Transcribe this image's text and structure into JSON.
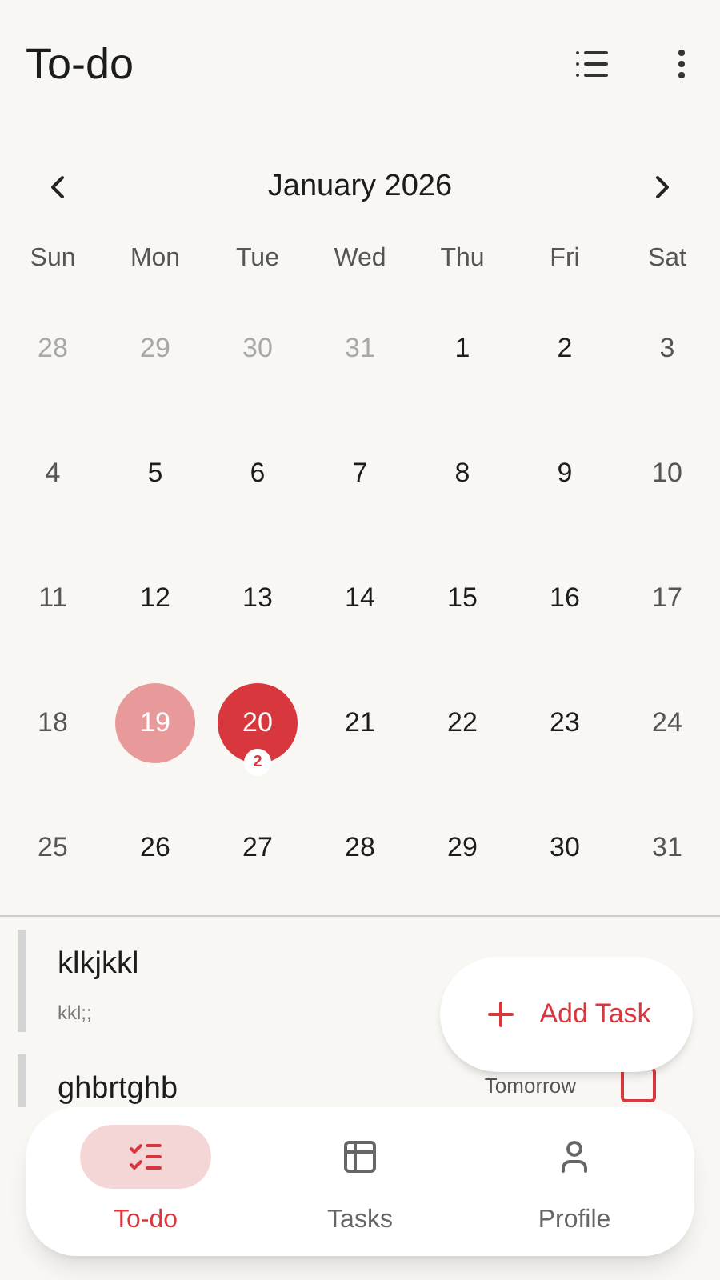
{
  "app_bar": {
    "title": "To-do"
  },
  "calendar": {
    "month": "January 2026",
    "weekdays": [
      "Sun",
      "Mon",
      "Tue",
      "Wed",
      "Thu",
      "Fri",
      "Sat"
    ],
    "days": [
      {
        "day": "28",
        "kind": "outside"
      },
      {
        "day": "29",
        "kind": "outside"
      },
      {
        "day": "30",
        "kind": "outside"
      },
      {
        "day": "31",
        "kind": "outside"
      },
      {
        "day": "1",
        "kind": "weekday"
      },
      {
        "day": "2",
        "kind": "weekday"
      },
      {
        "day": "3",
        "kind": "weekend"
      },
      {
        "day": "4",
        "kind": "weekend"
      },
      {
        "day": "5",
        "kind": "weekday"
      },
      {
        "day": "6",
        "kind": "weekday"
      },
      {
        "day": "7",
        "kind": "weekday"
      },
      {
        "day": "8",
        "kind": "weekday"
      },
      {
        "day": "9",
        "kind": "weekday"
      },
      {
        "day": "10",
        "kind": "weekend"
      },
      {
        "day": "11",
        "kind": "weekend"
      },
      {
        "day": "12",
        "kind": "weekday"
      },
      {
        "day": "13",
        "kind": "weekday"
      },
      {
        "day": "14",
        "kind": "weekday"
      },
      {
        "day": "15",
        "kind": "weekday"
      },
      {
        "day": "16",
        "kind": "weekday"
      },
      {
        "day": "17",
        "kind": "weekend"
      },
      {
        "day": "18",
        "kind": "weekend"
      },
      {
        "day": "19",
        "kind": "selected"
      },
      {
        "day": "20",
        "kind": "today",
        "badge": "2"
      },
      {
        "day": "21",
        "kind": "weekday"
      },
      {
        "day": "22",
        "kind": "weekday"
      },
      {
        "day": "23",
        "kind": "weekday"
      },
      {
        "day": "24",
        "kind": "weekend"
      },
      {
        "day": "25",
        "kind": "weekend"
      },
      {
        "day": "26",
        "kind": "weekday"
      },
      {
        "day": "27",
        "kind": "weekday"
      },
      {
        "day": "28",
        "kind": "weekday"
      },
      {
        "day": "29",
        "kind": "weekday"
      },
      {
        "day": "30",
        "kind": "weekday"
      },
      {
        "day": "31",
        "kind": "weekend"
      }
    ]
  },
  "tasks": [
    {
      "title": "klkjkkl",
      "note": "kkl;;"
    },
    {
      "title": "ghbrtghb",
      "due": "Tomorrow",
      "checked": false
    }
  ],
  "fab": {
    "label": "Add Task"
  },
  "nav": [
    {
      "label": "To-do",
      "kind": "todo",
      "selected": true
    },
    {
      "label": "Tasks",
      "kind": "tasks",
      "selected": false
    },
    {
      "label": "Profile",
      "kind": "profile",
      "selected": false
    }
  ]
}
